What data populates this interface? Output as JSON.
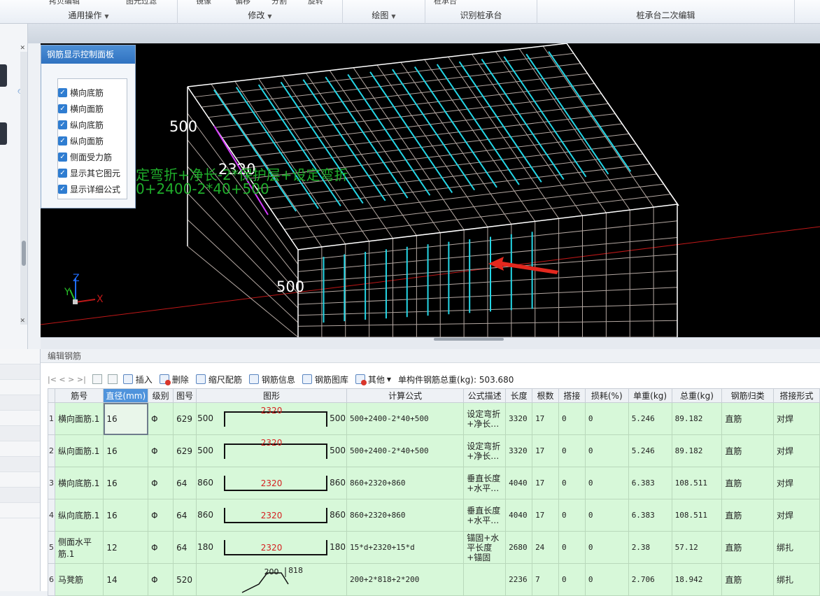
{
  "ribbon": {
    "groups": [
      {
        "label": "通用操作"
      },
      {
        "label": "修改"
      },
      {
        "label": "绘图"
      },
      {
        "label": "识别桩承台"
      },
      {
        "label": "桩承台二次编辑"
      }
    ],
    "fragments": [
      "拷贝编辑",
      "图元过滤",
      "镜像",
      "偏移",
      "分割",
      "旋转",
      "桩承台"
    ]
  },
  "rebar_panel": {
    "title": "钢筋显示控制面板",
    "options": [
      {
        "label": "横向底筋",
        "checked": true
      },
      {
        "label": "横向面筋",
        "checked": true
      },
      {
        "label": "纵向底筋",
        "checked": true
      },
      {
        "label": "纵向面筋",
        "checked": true
      },
      {
        "label": "侧面受力筋",
        "checked": true
      },
      {
        "label": "显示其它图元",
        "checked": true
      },
      {
        "label": "显示详细公式",
        "checked": true
      }
    ]
  },
  "viewport": {
    "dim_a": "500",
    "dim_b": "2320",
    "dim_c": "500",
    "formula_line1": "定弯折+净长-2*保护层+设定弯折",
    "formula_line2": "0+2400-2*40+500",
    "axis_x": "X",
    "axis_y": "Y",
    "axis_z": "Z",
    "colors": {
      "wire": "#b4a8a2",
      "rebar": "#24d6e6",
      "arrow": "#e3281e",
      "axis_line": "#c01818"
    }
  },
  "editor": {
    "title": "编辑钢筋",
    "toolbar": {
      "nav": "|<  <  >  >|",
      "insert": "插入",
      "delete": "删除",
      "scale": "缩尺配筋",
      "info": "钢筋信息",
      "library": "钢筋图库",
      "other": "其他",
      "total_weight": "单构件钢筋总重(kg): 503.680"
    },
    "columns": [
      "筋号",
      "直径(mm)",
      "级别",
      "图号",
      "图形",
      "计算公式",
      "公式描述",
      "长度",
      "根数",
      "搭接",
      "损耗(%)",
      "单重(kg)",
      "总重(kg)",
      "钢筋归类",
      "搭接形式"
    ],
    "rows": [
      {
        "no": "1",
        "name": "横向面筋.1",
        "dia": "16",
        "grade": "Φ",
        "fig": "629",
        "left": "500",
        "mid": "2320",
        "right": "500",
        "formula": "500+2400-2*40+500",
        "desc": "设定弯折+净长…",
        "len": "3320",
        "count": "17",
        "lap": "0",
        "loss": "0",
        "unit": "5.246",
        "total": "89.182",
        "cat": "直筋",
        "lapType": "对焊",
        "shape": "top"
      },
      {
        "no": "2",
        "name": "纵向面筋.1",
        "dia": "16",
        "grade": "Φ",
        "fig": "629",
        "left": "500",
        "mid": "2320",
        "right": "500",
        "formula": "500+2400-2*40+500",
        "desc": "设定弯折+净长…",
        "len": "3320",
        "count": "17",
        "lap": "0",
        "loss": "0",
        "unit": "5.246",
        "total": "89.182",
        "cat": "直筋",
        "lapType": "对焊",
        "shape": "top"
      },
      {
        "no": "3",
        "name": "横向底筋.1",
        "dia": "16",
        "grade": "Φ",
        "fig": "64",
        "left": "860",
        "mid": "2320",
        "right": "860",
        "formula": "860+2320+860",
        "desc": "垂直长度+水平…",
        "len": "4040",
        "count": "17",
        "lap": "0",
        "loss": "0",
        "unit": "6.383",
        "total": "108.511",
        "cat": "直筋",
        "lapType": "对焊",
        "shape": "bot"
      },
      {
        "no": "4",
        "name": "纵向底筋.1",
        "dia": "16",
        "grade": "Φ",
        "fig": "64",
        "left": "860",
        "mid": "2320",
        "right": "860",
        "formula": "860+2320+860",
        "desc": "垂直长度+水平…",
        "len": "4040",
        "count": "17",
        "lap": "0",
        "loss": "0",
        "unit": "6.383",
        "total": "108.511",
        "cat": "直筋",
        "lapType": "对焊",
        "shape": "bot"
      },
      {
        "no": "5",
        "name": "侧面水平筋.1",
        "dia": "12",
        "grade": "Φ",
        "fig": "64",
        "left": "180",
        "mid": "2320",
        "right": "180",
        "formula": "15*d+2320+15*d",
        "desc": "锚固+水平长度+锚固",
        "len": "2680",
        "count": "24",
        "lap": "0",
        "loss": "0",
        "unit": "2.38",
        "total": "57.12",
        "cat": "直筋",
        "lapType": "绑扎",
        "shape": "bot"
      },
      {
        "no": "6",
        "name": "马凳筋",
        "dia": "14",
        "grade": "Φ",
        "fig": "520",
        "left": "",
        "mid": "200",
        "right": "818",
        "formula": "200+2*818+2*200",
        "desc": "",
        "len": "2236",
        "count": "7",
        "lap": "0",
        "loss": "0",
        "unit": "2.706",
        "total": "18.942",
        "cat": "直筋",
        "lapType": "绑扎",
        "shape": "chair"
      }
    ]
  }
}
